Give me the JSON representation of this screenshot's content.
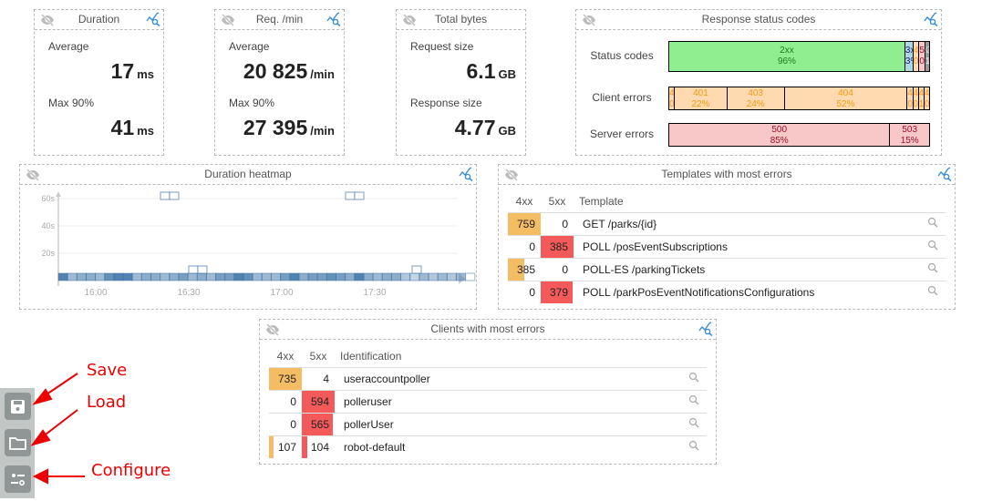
{
  "colors": {
    "accent": "#3d8fd6",
    "orange_bar": "#f5bd63",
    "red_bar": "#f55a5a",
    "2xx": "#90ee90",
    "3xx": "#add8e6",
    "4xx": "#ffdab0",
    "5xx": "#f8c8c8",
    "none": "#999999",
    "heat": "#3f74a6"
  },
  "duration": {
    "title": "Duration",
    "avg_label": "Average",
    "avg_value": "17",
    "avg_unit": "ms",
    "max_label": "Max 90%",
    "max_value": "41",
    "max_unit": "ms"
  },
  "requests": {
    "title": "Req. /min",
    "avg_label": "Average",
    "avg_value": "20 825",
    "avg_unit": "/min",
    "max_label": "Max 90%",
    "max_value": "27 395",
    "max_unit": "/min"
  },
  "bytes": {
    "title": "Total bytes",
    "req_label": "Request size",
    "req_value": "6.1",
    "req_unit": "GB",
    "resp_label": "Response size",
    "resp_value": "4.77",
    "resp_unit": "GB"
  },
  "status": {
    "title": "Response status codes",
    "rows": [
      {
        "label": "Status codes",
        "segments": [
          {
            "code": "2xx",
            "pct": "96%",
            "w": 96,
            "bg": "#90ee90",
            "fg": "#207a20"
          },
          {
            "code": "3xx",
            "pct": "3%",
            "w": 3,
            "bg": "#add8e6",
            "fg": "#1a237e"
          },
          {
            "code": "4xx",
            "pct": "0%",
            "w": 2,
            "bg": "#ffdab0",
            "fg": "#f39c12"
          },
          {
            "code": "5xx",
            "pct": "0%",
            "w": 2,
            "bg": "#f8c8c8",
            "fg": "#a0102a"
          },
          {
            "code": "∅",
            "pct": "1%",
            "w": 1.6,
            "bg": "#999999",
            "fg": "#eeeeee"
          }
        ]
      },
      {
        "label": "Client errors",
        "segments": [
          {
            "code": "400",
            "pct": "0%",
            "w": 2,
            "bg": "#ffdab0",
            "fg": "#f39c12"
          },
          {
            "code": "401",
            "pct": "22%",
            "w": 22,
            "bg": "#ffdab0",
            "fg": "#f39c12"
          },
          {
            "code": "403",
            "pct": "24%",
            "w": 24,
            "bg": "#ffdab0",
            "fg": "#f39c12"
          },
          {
            "code": "404",
            "pct": "52%",
            "w": 52,
            "bg": "#ffdab0",
            "fg": "#f39c12"
          },
          {
            "code": "405",
            "pct": "0%",
            "w": 2,
            "bg": "#ffdab0",
            "fg": "#f39c12"
          },
          {
            "code": "409",
            "pct": "0%",
            "w": 2,
            "bg": "#ffdab0",
            "fg": "#f39c12"
          },
          {
            "code": "422",
            "pct": "1%",
            "w": 2,
            "bg": "#ffdab0",
            "fg": "#f39c12"
          },
          {
            "code": "424",
            "pct": "0%",
            "w": 2,
            "bg": "#ffdab0",
            "fg": "#f39c12"
          }
        ]
      },
      {
        "label": "Server errors",
        "segments": [
          {
            "code": "500",
            "pct": "85%",
            "w": 85,
            "bg": "#f8c8c8",
            "fg": "#a0102a"
          },
          {
            "code": "503",
            "pct": "15%",
            "w": 15,
            "bg": "#f8c8c8",
            "fg": "#a0102a"
          }
        ]
      }
    ]
  },
  "heatmap": {
    "title": "Duration heatmap",
    "chart_data": {
      "type": "heatmap",
      "y_ticks": [
        "60s",
        "40s",
        "20s"
      ],
      "x_ticks": [
        "16:00",
        "16:30",
        "17:00",
        "17:30"
      ],
      "bottom_row_intensity": [
        0.9,
        0.5,
        0.6,
        0.6,
        0.5,
        0.8,
        0.9,
        0.9,
        0.5,
        0.6,
        0.6,
        0.5,
        0.6,
        0.7,
        0.5,
        0.6,
        0.5,
        0.7,
        0.7,
        0.9,
        0.8,
        0.5,
        0.5,
        0.5,
        0.7,
        0.9,
        0.6,
        0.7,
        0.7,
        0.8,
        0.7,
        0.6,
        0.9,
        0.6,
        0.5,
        0.6,
        0.6,
        0.4,
        0.3,
        0.5,
        0.4,
        0.5,
        0.4,
        0.5,
        0.0
      ],
      "outliers": [
        {
          "col": 36.7,
          "y": 60
        },
        {
          "col": 37.7,
          "y": 60
        },
        {
          "col": 56.7,
          "y": 60
        },
        {
          "col": 57.7,
          "y": 60
        },
        {
          "col": 39.7,
          "y": 5
        },
        {
          "col": 40.7,
          "y": 5
        },
        {
          "col": 41.4,
          "y": 5
        },
        {
          "col": 80.0,
          "y": 5
        }
      ]
    }
  },
  "templates": {
    "title": "Templates with most errors",
    "headers": [
      "4xx",
      "5xx",
      "Template"
    ],
    "rows": [
      {
        "c4": "759",
        "f4": 1,
        "c5": "0",
        "f5": 0,
        "name": "GET /parks/{id}"
      },
      {
        "c4": "0",
        "f4": 0,
        "c5": "385",
        "f5": 1,
        "name": "POLL /posEventSubscriptions"
      },
      {
        "c4": "385",
        "f4": 0.51,
        "c5": "0",
        "f5": 0,
        "name": "POLL-ES /parkingTickets"
      },
      {
        "c4": "0",
        "f4": 0,
        "c5": "379",
        "f5": 0.98,
        "name": "POLL /parkPosEventNotificationsConfigurations"
      }
    ]
  },
  "clients": {
    "title": "Clients with most errors",
    "headers": [
      "4xx",
      "5xx",
      "Identification"
    ],
    "rows": [
      {
        "c4": "735",
        "f4": 1,
        "c5": "4",
        "f5": 0,
        "name": "useraccountpoller"
      },
      {
        "c4": "0",
        "f4": 0,
        "c5": "594",
        "f5": 1,
        "name": "polleruser"
      },
      {
        "c4": "0",
        "f4": 0,
        "c5": "565",
        "f5": 0.95,
        "name": "pollerUser"
      },
      {
        "c4": "107",
        "f4": 0.15,
        "c5": "104",
        "f5": 0.18,
        "name": "robot-default"
      }
    ]
  },
  "annotations": {
    "save": "Save",
    "load": "Load",
    "configure": "Configure"
  }
}
